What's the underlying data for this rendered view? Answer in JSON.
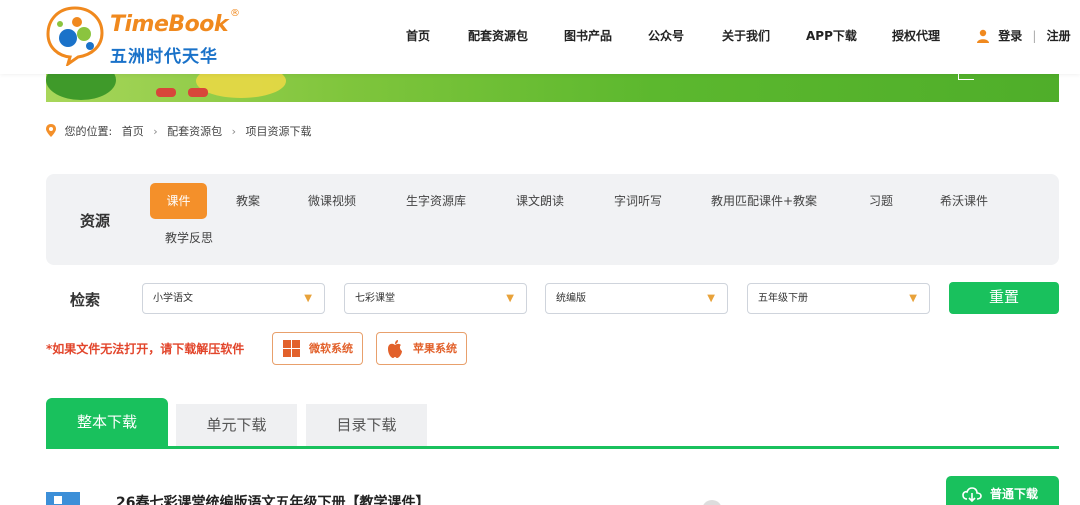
{
  "brand": {
    "name_en": "TimeBook",
    "reg": "®",
    "name_cn": "五洲时代天华"
  },
  "nav": {
    "items": [
      "首页",
      "配套资源包",
      "图书产品",
      "公众号",
      "关于我们",
      "APP下载",
      "授权代理"
    ],
    "login": "登录",
    "separator": "|",
    "register": "注册"
  },
  "breadcrumb": {
    "prefix": "您的位置:",
    "items": [
      "首页",
      "配套资源包",
      "项目资源下载"
    ]
  },
  "resources": {
    "label": "资源",
    "tabs": [
      "课件",
      "教案",
      "微课视频",
      "生字资源库",
      "课文朗读",
      "字词听写",
      "教用匹配课件+教案",
      "习题",
      "希沃课件",
      "教学反思"
    ],
    "active_index": 0
  },
  "filters": {
    "label": "检索",
    "selects": [
      "小学语文",
      "七彩课堂",
      "统编版",
      "五年级下册"
    ],
    "reset_label": "重置"
  },
  "notice": {
    "text": "*如果文件无法打开，请下载解压软件",
    "windows_label": "微软系统",
    "apple_label": "苹果系统"
  },
  "download_tabs": {
    "items": [
      "整本下载",
      "单元下载",
      "目录下载"
    ],
    "active_index": 0
  },
  "list": {
    "items": [
      {
        "title": "26春七彩课堂统编版语文五年级下册【教学课件】",
        "button": "普通下载"
      }
    ]
  },
  "colors": {
    "accent_green": "#19c15d",
    "accent_orange": "#f4902a",
    "notice_red": "#e2452b"
  }
}
